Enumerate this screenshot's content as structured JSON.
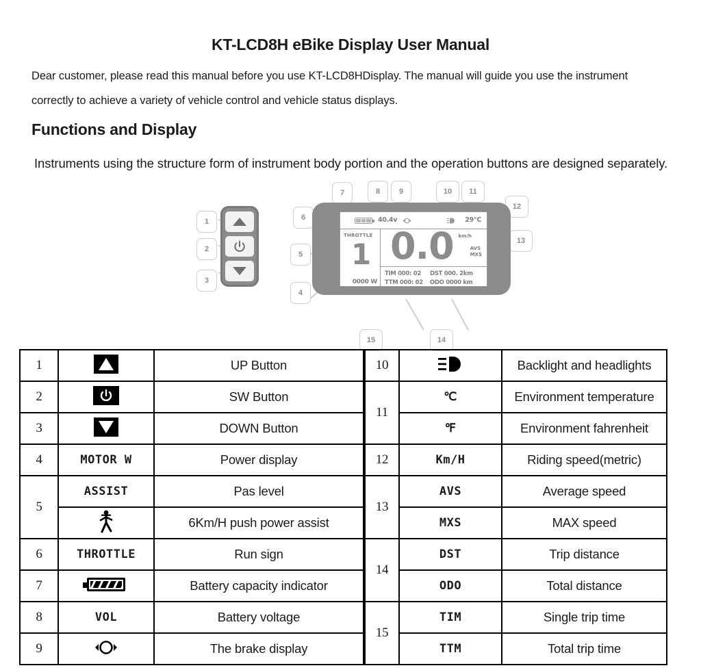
{
  "document": {
    "title": "KT-LCD8H eBike Display User Manual",
    "intro": "Dear customer, please read this manual before you use KT-LCD8HDisplay. The manual will guide you use the instrument correctly to achieve a variety of vehicle control and vehicle status displays.",
    "section_title": "Functions and Display",
    "section_body": "Instruments using the structure form of instrument body portion and the operation buttons are designed separately."
  },
  "diagram": {
    "callouts": [
      "1",
      "2",
      "3",
      "4",
      "5",
      "6",
      "7",
      "8",
      "9",
      "10",
      "11",
      "12",
      "13",
      "14",
      "15"
    ],
    "keypad": {
      "up_icon": "triangle-up-icon",
      "power_icon": "power-icon",
      "down_icon": "triangle-down-icon"
    },
    "lcd": {
      "battery_icon": "battery-icon",
      "voltage": "40.4v",
      "brake_icon": "brake-icon",
      "headlight_icon": "headlight-icon",
      "temperature": "29°C",
      "throttle_label": "THROTTLE",
      "pas_level": "1",
      "power": "0000 W",
      "speed": "0.0",
      "speed_unit": "km/h",
      "avs_label": "AVS",
      "mxs_label": "MXS",
      "tim": "TIM 000: 02",
      "ttm": "TTM 000: 02",
      "dst": "DST 000. 2km",
      "odo": "ODO 0000 km"
    }
  },
  "table_left": [
    {
      "num": "1",
      "symbol": "",
      "icon": "up-button-icon",
      "desc": "UP Button"
    },
    {
      "num": "2",
      "symbol": "",
      "icon": "sw-button-icon",
      "desc": "SW Button"
    },
    {
      "num": "3",
      "symbol": "",
      "icon": "down-button-icon",
      "desc": "DOWN Button"
    },
    {
      "num": "4",
      "symbol": "MOTOR W",
      "icon": "",
      "desc": "Power display"
    },
    {
      "num": "5",
      "symbol": "ASSIST",
      "icon": "",
      "desc": "Pas level"
    },
    {
      "num": "",
      "symbol": "",
      "icon": "walking-person-icon",
      "desc": "6Km/H push power assist"
    },
    {
      "num": "6",
      "symbol": "THROTTLE",
      "icon": "",
      "desc": "Run sign"
    },
    {
      "num": "7",
      "symbol": "",
      "icon": "battery-capacity-icon",
      "desc": "Battery capacity indicator"
    },
    {
      "num": "8",
      "symbol": "VOL",
      "icon": "",
      "desc": "Battery voltage"
    },
    {
      "num": "9",
      "symbol": "",
      "icon": "brake-display-icon",
      "desc": "The brake display"
    }
  ],
  "table_right": [
    {
      "num": "10",
      "symbol": "",
      "icon": "headlight-icon",
      "desc": "Backlight and headlights"
    },
    {
      "num": "11",
      "symbol": "℃",
      "icon": "",
      "desc": "Environment temperature"
    },
    {
      "num": "",
      "symbol": "℉",
      "icon": "",
      "desc": "Environment fahrenheit"
    },
    {
      "num": "12",
      "symbol": "Km/H",
      "icon": "",
      "desc": "Riding speed(metric)"
    },
    {
      "num": "13",
      "symbol": "AVS",
      "icon": "",
      "desc": "Average speed"
    },
    {
      "num": "",
      "symbol": "MXS",
      "icon": "",
      "desc": "MAX speed"
    },
    {
      "num": "14",
      "symbol": "DST",
      "icon": "",
      "desc": "Trip distance"
    },
    {
      "num": "",
      "symbol": "ODO",
      "icon": "",
      "desc": "Total distance"
    },
    {
      "num": "15",
      "symbol": "TIM",
      "icon": "",
      "desc": "Single trip time"
    },
    {
      "num": "",
      "symbol": "TTM",
      "icon": "",
      "desc": "Total trip time"
    }
  ]
}
